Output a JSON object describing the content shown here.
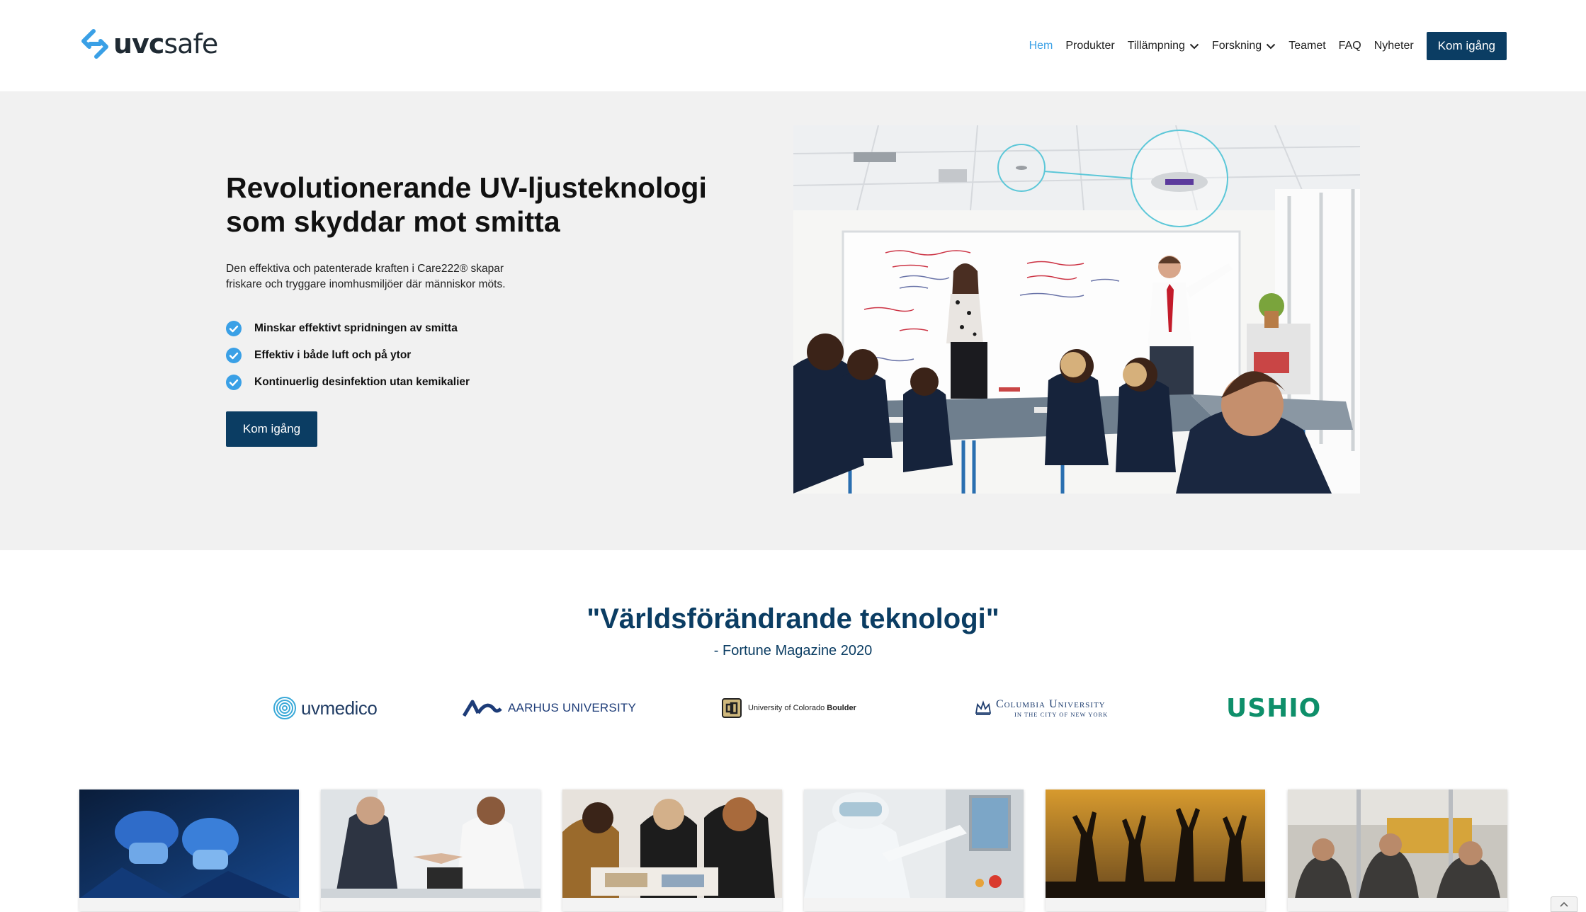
{
  "brand": {
    "name_bold": "uvc",
    "name_soft": "safe",
    "accent": "#3aa0e6",
    "dark": "#0b3d63"
  },
  "nav": {
    "items": [
      {
        "label": "Hem",
        "active": true,
        "dropdown": false
      },
      {
        "label": "Produkter",
        "active": false,
        "dropdown": false
      },
      {
        "label": "Tillämpning",
        "active": false,
        "dropdown": true
      },
      {
        "label": "Forskning",
        "active": false,
        "dropdown": true
      },
      {
        "label": "Teamet",
        "active": false,
        "dropdown": false
      },
      {
        "label": "FAQ",
        "active": false,
        "dropdown": false
      },
      {
        "label": "Nyheter",
        "active": false,
        "dropdown": false
      }
    ],
    "cta": "Kom igång"
  },
  "hero": {
    "title_line1": "Revolutionerande UV-ljusteknologi",
    "title_line2": "som skyddar mot smitta",
    "description_line1": "Den effektiva och patenterade kraften i Care222® skapar",
    "description_line2": "friskare och tryggare inomhusmiljöer där människor möts.",
    "checks": [
      "Minskar effektivt spridningen av smitta",
      "Effektiv i både luft och på ytor",
      "Kontinuerlig desinfektion utan kemikalier"
    ],
    "cta": "Kom igång",
    "background": "#f1f1f1"
  },
  "quote": {
    "text": "\"Världsförändrande teknologi\"",
    "source": "- Fortune Magazine 2020"
  },
  "partners": {
    "uvmedico": "uvmedico",
    "aarhus": "AARHUS UNIVERSITY",
    "colorado_prefix": "University of Colorado",
    "colorado_bold": "Boulder",
    "columbia_main": "Columbia University",
    "columbia_sub": "IN THE CITY OF NEW YORK",
    "ushio": "USHIO"
  },
  "cards": [
    {
      "image": "surgeons-icon"
    },
    {
      "image": "handshake-icon"
    },
    {
      "image": "students-icon"
    },
    {
      "image": "lab-worker-icon"
    },
    {
      "image": "concert-crowd-icon"
    },
    {
      "image": "commuters-icon"
    }
  ]
}
